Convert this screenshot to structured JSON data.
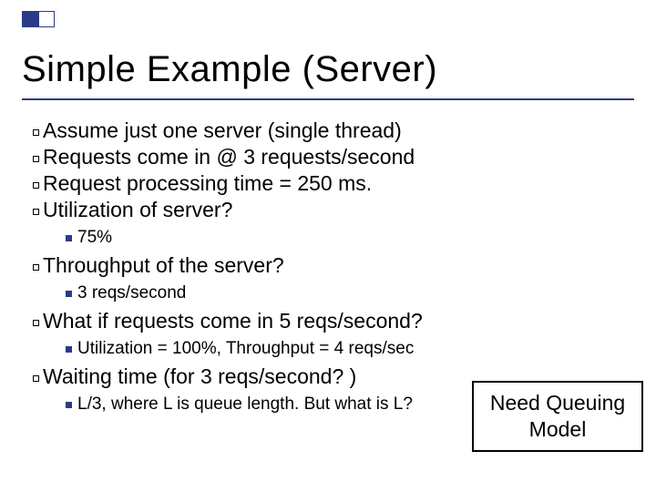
{
  "title": "Simple Example (Server)",
  "bullets": {
    "b1": "Assume just one server (single thread)",
    "b2": "Requests come in @ 3 requests/second",
    "b3": "Request processing time = 250 ms.",
    "b4": "Utilization of server?",
    "b4s": " 75%",
    "b5": "Throughput of the server?",
    "b5s": "3 reqs/second",
    "b6": "What if requests come in 5 reqs/second?",
    "b6s": "Utilization = 100%, Throughput = 4 reqs/sec",
    "b7": "Waiting time (for 3 reqs/second? )",
    "b7s": "L/3, where L is queue length. But what is L?"
  },
  "callout": "Need Queuing Model"
}
